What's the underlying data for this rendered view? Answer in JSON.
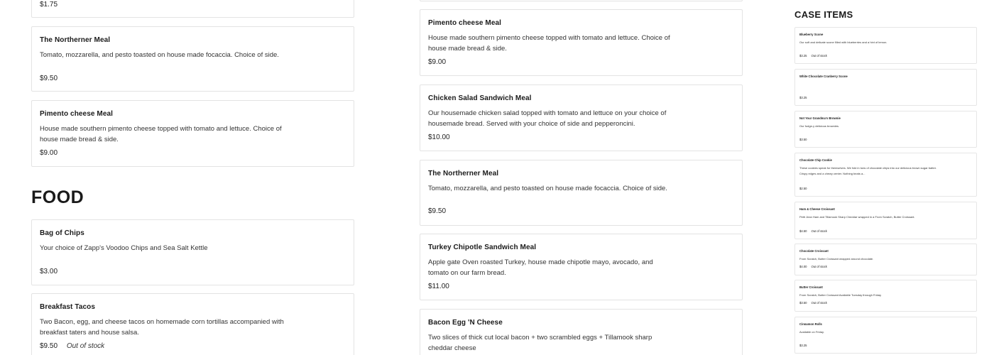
{
  "left_column": {
    "top_partial_price": "$1.75",
    "items": [
      {
        "title": "The Northerner Meal",
        "desc": "Tomato, mozzarella, and pesto toasted on house made focaccia. Choice of side.",
        "price": "$9.50"
      },
      {
        "title": "Pimento cheese Meal",
        "desc": "House made southern pimento cheese topped with tomato and lettuce. Choice of house made bread & side.",
        "price": "$9.00"
      }
    ],
    "food_heading": "FOOD",
    "food_items": [
      {
        "title": "Bag of Chips",
        "desc": "Your choice of Zapp's Voodoo Chips and Sea Salt Kettle",
        "price": "$3.00"
      },
      {
        "title": "Breakfast Tacos",
        "desc": "Two Bacon, egg, and cheese tacos on homemade corn tortillas accompanied with breakfast taters and house salsa.",
        "price": "$9.50",
        "status": "Out of stock"
      }
    ]
  },
  "middle_column": {
    "items": [
      {
        "title": "Pimento cheese Meal",
        "desc": "House made southern pimento cheese topped with tomato and lettuce. Choice of house made bread & side.",
        "price": "$9.00"
      },
      {
        "title": "Chicken Salad Sandwich Meal",
        "desc": "Our housemade chicken salad topped with tomato and lettuce on your choice of housemade bread. Served with your choice of side and pepperoncini.",
        "price": "$10.00"
      },
      {
        "title": "The Northerner Meal",
        "desc": "Tomato, mozzarella, and pesto toasted on house made focaccia. Choice of side.",
        "price": "$9.50"
      },
      {
        "title": "Turkey Chipotle Sandwich Meal",
        "desc": "Apple gate Oven roasted Turkey, house made chipotle mayo, avocado, and tomato on our farm bread.",
        "price": "$11.00"
      },
      {
        "title": "Bacon Egg 'N Cheese",
        "desc": "Two slices of thick cut local bacon + two scrambled eggs + Tillamook sharp cheddar cheese",
        "price": ""
      }
    ]
  },
  "sidebar": {
    "title": "CASE ITEMS",
    "items": [
      {
        "title": "Blueberry Scone",
        "desc": "Our soft and delicate scone filled with blueberries and a hint of lemon.",
        "price": "$3.25",
        "status": "Out of stock"
      },
      {
        "title": "White Chocolate Cranberry Scone",
        "desc": "",
        "price": "$3.25",
        "status": ""
      },
      {
        "title": "Not Your Grandma's Brownie",
        "desc": "Our fudge-y delicious brownies.",
        "price": "$3.50",
        "status": ""
      },
      {
        "title": "Chocolate Chip Cookie",
        "desc": "These cookies speak for themselves. We fold in tons of chocolate chips into our delicious brown sugar batter. Crispy edges and a chewy center. Nothing beats a...",
        "price": "$2.50",
        "status": ""
      },
      {
        "title": "Ham & Cheese Croissant",
        "desc": "Petit Jean Ham and Tillamook Sharp Cheddar wrapped in a From Scratch, Butter Croissant.",
        "price": "$4.50",
        "status": "Out of stock"
      },
      {
        "title": "Chocolate Croissant",
        "desc": "From Scratch, Butter Croissant wrapped around chocolate.",
        "price": "$4.00",
        "status": "Out of stock"
      },
      {
        "title": "Butter Croissant",
        "desc": "From Scratch, Butter Croissant Available Tuesday through Friday",
        "price": "$3.50",
        "status": "Out of stock"
      },
      {
        "title": "Cinnamon Rolls",
        "desc": "Available on Friday.",
        "price": "$3.25",
        "status": ""
      }
    ]
  }
}
